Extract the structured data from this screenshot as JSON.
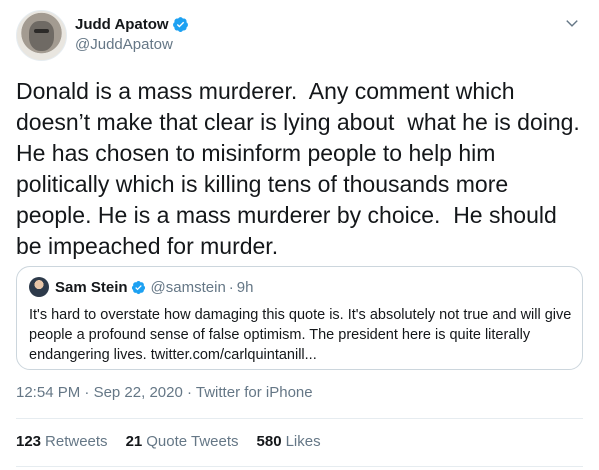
{
  "author": {
    "display_name": "Judd Apatow",
    "handle": "@JuddApatow",
    "verified_icon": "verified-badge-icon",
    "verified_color": "#1da1f2"
  },
  "tweet": {
    "text": "Donald is a mass murderer.  Any comment which doesn’t make that clear is lying about  what he is doing. He has chosen to misinform people to help him politically which is killing tens of thousands more people. He is a mass murderer by choice.  He should be impeached for murder."
  },
  "quote": {
    "display_name": "Sam Stein",
    "handle": "@samstein",
    "separator": "·",
    "time": "9h",
    "text": "It's hard to overstate how damaging this quote is. It's absolutely not true and will give people a profound sense of false optimism. The president here is quite literally endangering lives. twitter.com/carlquintanill..."
  },
  "meta": {
    "time": "12:54 PM",
    "separator": "·",
    "date": "Sep 22, 2020",
    "source": "Twitter for iPhone"
  },
  "stats": {
    "retweets_count": "123",
    "retweets_label": "Retweets",
    "quotes_count": "21",
    "quotes_label": "Quote Tweets",
    "likes_count": "580",
    "likes_label": "Likes"
  },
  "colors": {
    "text": "#14171a",
    "secondary": "#657786",
    "border": "#ccd6dd",
    "accent": "#1da1f2"
  }
}
